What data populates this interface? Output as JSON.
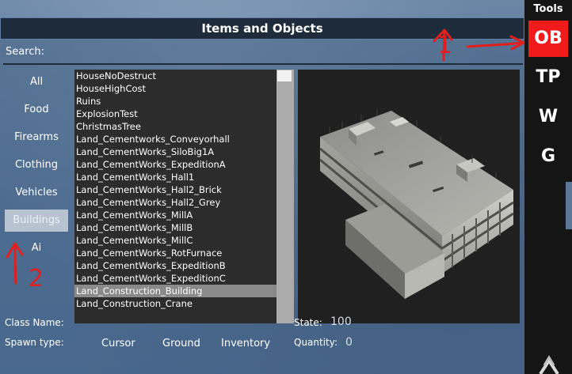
{
  "panel": {
    "title": "Items and Objects",
    "search": {
      "label": "Search:",
      "value": "",
      "placeholder": ""
    }
  },
  "categories": [
    {
      "label": "All",
      "selected": false
    },
    {
      "label": "Food",
      "selected": false
    },
    {
      "label": "Firearms",
      "selected": false
    },
    {
      "label": "Clothing",
      "selected": false
    },
    {
      "label": "Vehicles",
      "selected": false
    },
    {
      "label": "Buildings",
      "selected": true
    },
    {
      "label": "Ai",
      "selected": false
    }
  ],
  "object_list": {
    "items": [
      "HouseNoDestruct",
      "HouseHighCost",
      "Ruins",
      "ExplosionTest",
      "ChristmasTree",
      "Land_Cementworks_Conveyorhall",
      "Land_CementWorks_SiloBig1A",
      "Land_CementWorks_ExpeditionA",
      "Land_CementWorks_Hall1",
      "Land_CementWorks_Hall2_Brick",
      "Land_CementWorks_Hall2_Grey",
      "Land_CementWorks_MillA",
      "Land_CementWorks_MillB",
      "Land_CementWorks_MillC",
      "Land_CementWorks_RotFurnace",
      "Land_CementWorks_ExpeditionB",
      "Land_CementWorks_ExpeditionC",
      "Land_Construction_Building",
      "Land_Construction_Crane"
    ],
    "selected": "Land_Construction_Building"
  },
  "info": {
    "class_name_label": "Class Name:",
    "class_name_value": "",
    "state_label": "State:",
    "state_value": "100",
    "spawn_type_label": "Spawn type:",
    "spawn_options": [
      "Cursor",
      "Ground",
      "Inventory"
    ],
    "quantity_label": "Quantity:",
    "quantity_value": "0"
  },
  "tools": {
    "label": "Tools",
    "buttons": [
      {
        "label": "OB",
        "active": true
      },
      {
        "label": "TP",
        "active": false
      },
      {
        "label": "W",
        "active": false
      },
      {
        "label": "G",
        "active": false
      }
    ]
  },
  "annotations": {
    "label_1": "1",
    "label_2": "2",
    "color": "#e0201e"
  },
  "colors": {
    "title_bar": "#1d2b3a",
    "active_tool": "#f21b1b",
    "selected_category": "#b7c3d0",
    "list_background": "#2c2c2c",
    "selected_row": "#8a8a8a"
  }
}
